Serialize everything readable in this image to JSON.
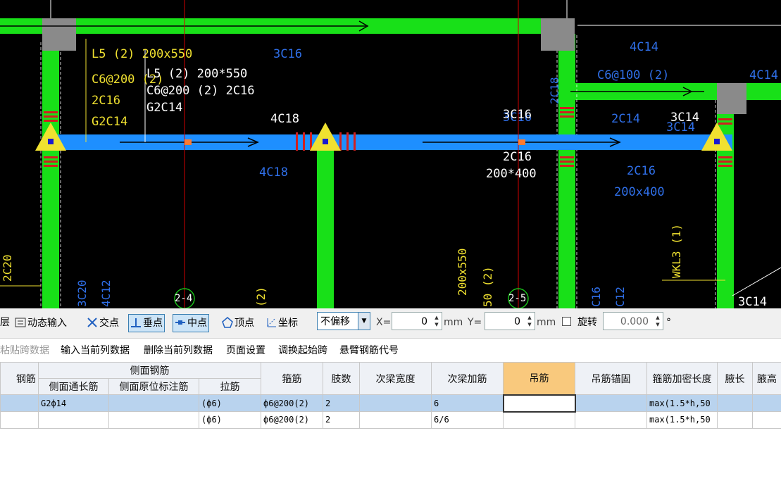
{
  "cad": {
    "beam_labels": {
      "l5_name": "L5 (2)  200x550",
      "l5_stirrup": "C6@200 (2)",
      "l5_top": "2C16",
      "l5_side": "G2C14",
      "l5_overlay_name": "L5 (2)  200*550",
      "l5_overlay_stirrup": "C6@200 (2)  2C16",
      "l5_overlay_side": "G2C14",
      "top_mid": "3C16",
      "left_support_top": "4C18",
      "left_support_bottom": "4C18",
      "mid_support_top_a": "3C16",
      "mid_support_top_b": "3C16",
      "mid_bottom": "2C16",
      "mid_size": "200*400",
      "right_top_4c14": "4C14",
      "right_stirrup": "C6@100 (2)",
      "right_4c14_edge": "4C14",
      "right_2c14": "2C14",
      "right_3c14_a": "3C14",
      "right_3c14_b": "3C14",
      "right_2c16": "2C16",
      "right_size": "200x400",
      "wkl3": "WKL3 (1)",
      "bottom_3c14": "3C14",
      "vert_2c20": "2C20",
      "vert_3c20": "3C20",
      "vert_4c12": "4C12",
      "vert_paren": "(2)",
      "vert_200x550": "200x550",
      "vert_50_2": "50 (2)",
      "vert_c16": "C16",
      "vert_c12": "C12",
      "vert_2c18": "2C18",
      "axis_2_4": "2-4",
      "axis_2_5": "2-5"
    }
  },
  "snapbar": {
    "left_cut": "层",
    "dynamic_input": "动态输入",
    "intersection": "交点",
    "perpendicular": "垂点",
    "midpoint": "中点",
    "vertex": "顶点",
    "coordinate": "坐标",
    "offset_mode": "不偏移",
    "x_label": "X=",
    "x_value": "0",
    "x_unit": "mm",
    "y_label": "Y=",
    "y_value": "0",
    "y_unit": "mm",
    "rotate_label": "旋转",
    "rotate_value": "0.000",
    "degree": "°"
  },
  "toolbar": {
    "paste_span": "粘贴跨数据",
    "input_column": "输入当前列数据",
    "delete_column": "删除当前列数据",
    "page_setup": "页面设置",
    "swap_start": "调换起始跨",
    "cantilever": "悬臂钢筋代号"
  },
  "table": {
    "group_side": "侧面钢筋",
    "headers": {
      "c0": "钢筋",
      "c1": "侧面通长筋",
      "c2": "侧面原位标注筋",
      "c3": "拉筋",
      "c4": "箍筋",
      "c5": "肢数",
      "c6": "次梁宽度",
      "c7": "次梁加筋",
      "c8": "吊筋",
      "c9": "吊筋锚固",
      "c10": "箍筋加密长度",
      "c11": "腋长",
      "c12": "腋高"
    },
    "rows": [
      {
        "c0": "",
        "c1": "G2ф14",
        "c2": "",
        "c3": "(ф6)",
        "c4": "ф6@200(2)",
        "c5": "2",
        "c6": "",
        "c7": "6",
        "c8": "",
        "c9": "",
        "c10": "max(1.5*h,50",
        "c11": "",
        "c12": ""
      },
      {
        "c0": "",
        "c1": "",
        "c2": "",
        "c3": "(ф6)",
        "c4": "ф6@200(2)",
        "c5": "2",
        "c6": "",
        "c7": "6/6",
        "c8": "",
        "c9": "",
        "c10": "max(1.5*h,50",
        "c11": "",
        "c12": ""
      }
    ]
  },
  "colors": {
    "beam_green": "#18e018",
    "beam_blue": "#1e8fff",
    "label_yellow": "#f0e130",
    "label_blue": "#2f6fe8",
    "label_white": "#ffffff",
    "axis_red": "#d00000",
    "column_gray": "#8a8a8a"
  }
}
